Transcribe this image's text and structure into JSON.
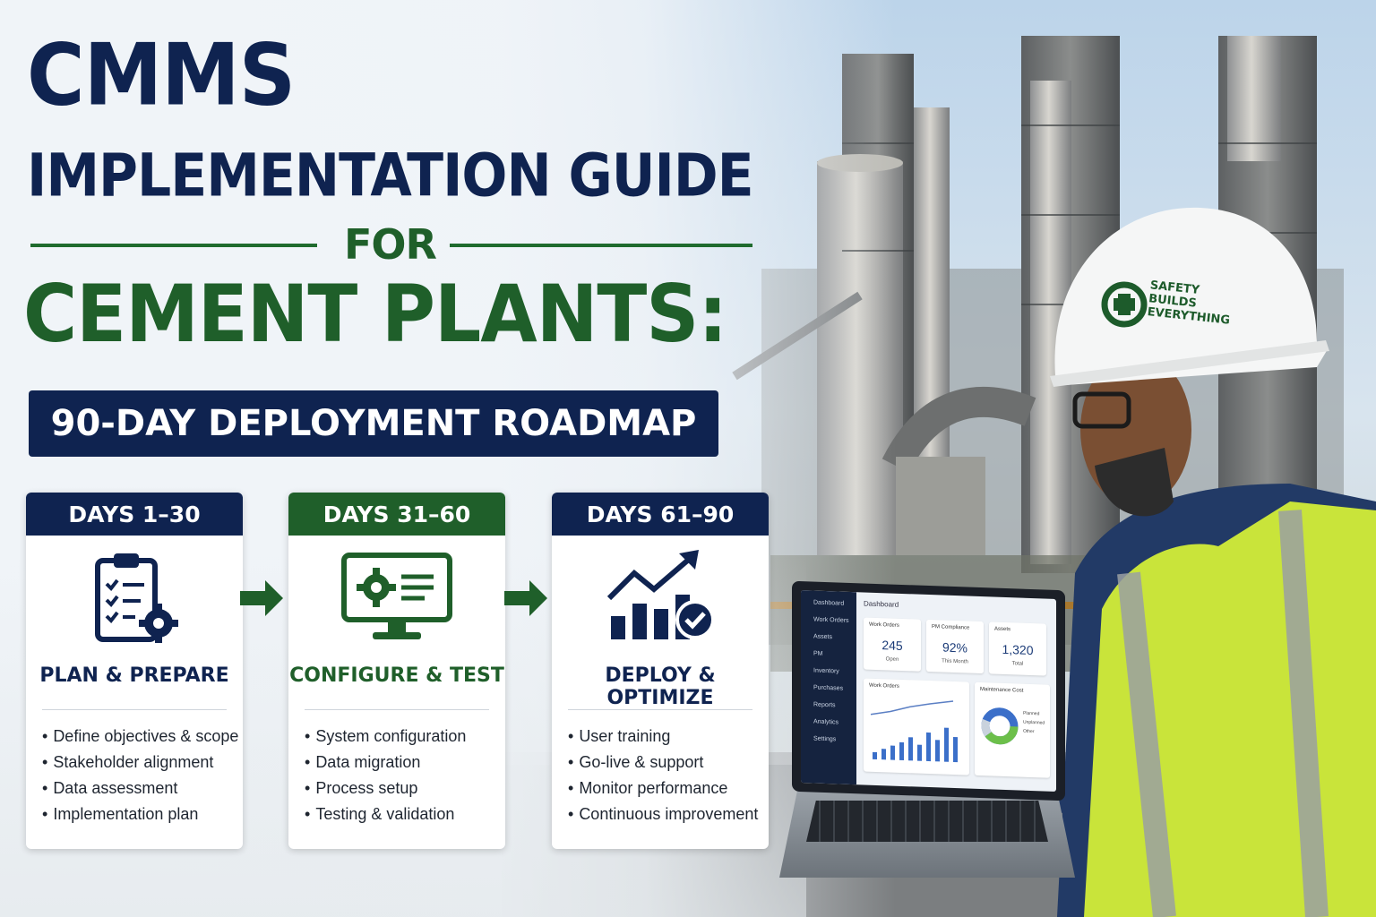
{
  "headline": {
    "line1": "CMMS",
    "line2": "IMPLEMENTATION GUIDE",
    "for": "FOR",
    "line3": "CEMENT PLANTS:",
    "banner": "90-DAY DEPLOYMENT ROADMAP"
  },
  "colors": {
    "navy": "#0f2350",
    "green": "#1f5f2a",
    "vest": "#c9e43a"
  },
  "phases": [
    {
      "days": "DAYS 1–30",
      "title": "PLAN & PREPARE",
      "icon": "clipboard-checklist-gear-icon",
      "items": [
        "Define objectives & scope",
        "Stakeholder alignment",
        "Data assessment",
        "Implementation plan"
      ]
    },
    {
      "days": "DAYS 31–60",
      "title": "CONFIGURE & TEST",
      "icon": "monitor-gear-icon",
      "items": [
        "System configuration",
        "Data migration",
        "Process setup",
        "Testing & validation"
      ]
    },
    {
      "days": "DAYS 61–90",
      "title": "DEPLOY & OPTIMIZE",
      "icon": "growth-chart-check-icon",
      "items": [
        "User training",
        "Go-live & support",
        "Monitor performance",
        "Continuous improvement"
      ]
    }
  ],
  "helmet": {
    "line1": "SAFETY",
    "line2": "BUILDS",
    "line3": "EVERYTHING"
  },
  "laptop": {
    "app_title": "Dashboard",
    "sidebar": [
      "Dashboard",
      "Work Orders",
      "Assets",
      "PM",
      "Inventory",
      "Purchases",
      "Reports",
      "Analytics",
      "Settings"
    ],
    "kpis": [
      {
        "label": "Work Orders",
        "value": "245",
        "sub": "Open"
      },
      {
        "label": "PM Compliance",
        "value": "92%",
        "sub": "This Month"
      },
      {
        "label": "Assets",
        "value": "1,320",
        "sub": "Total"
      }
    ],
    "panel_work_orders": "Work Orders",
    "panel_cost": "Maintenance Cost",
    "cost_legend": [
      "Planned",
      "Unplanned",
      "Other"
    ]
  }
}
